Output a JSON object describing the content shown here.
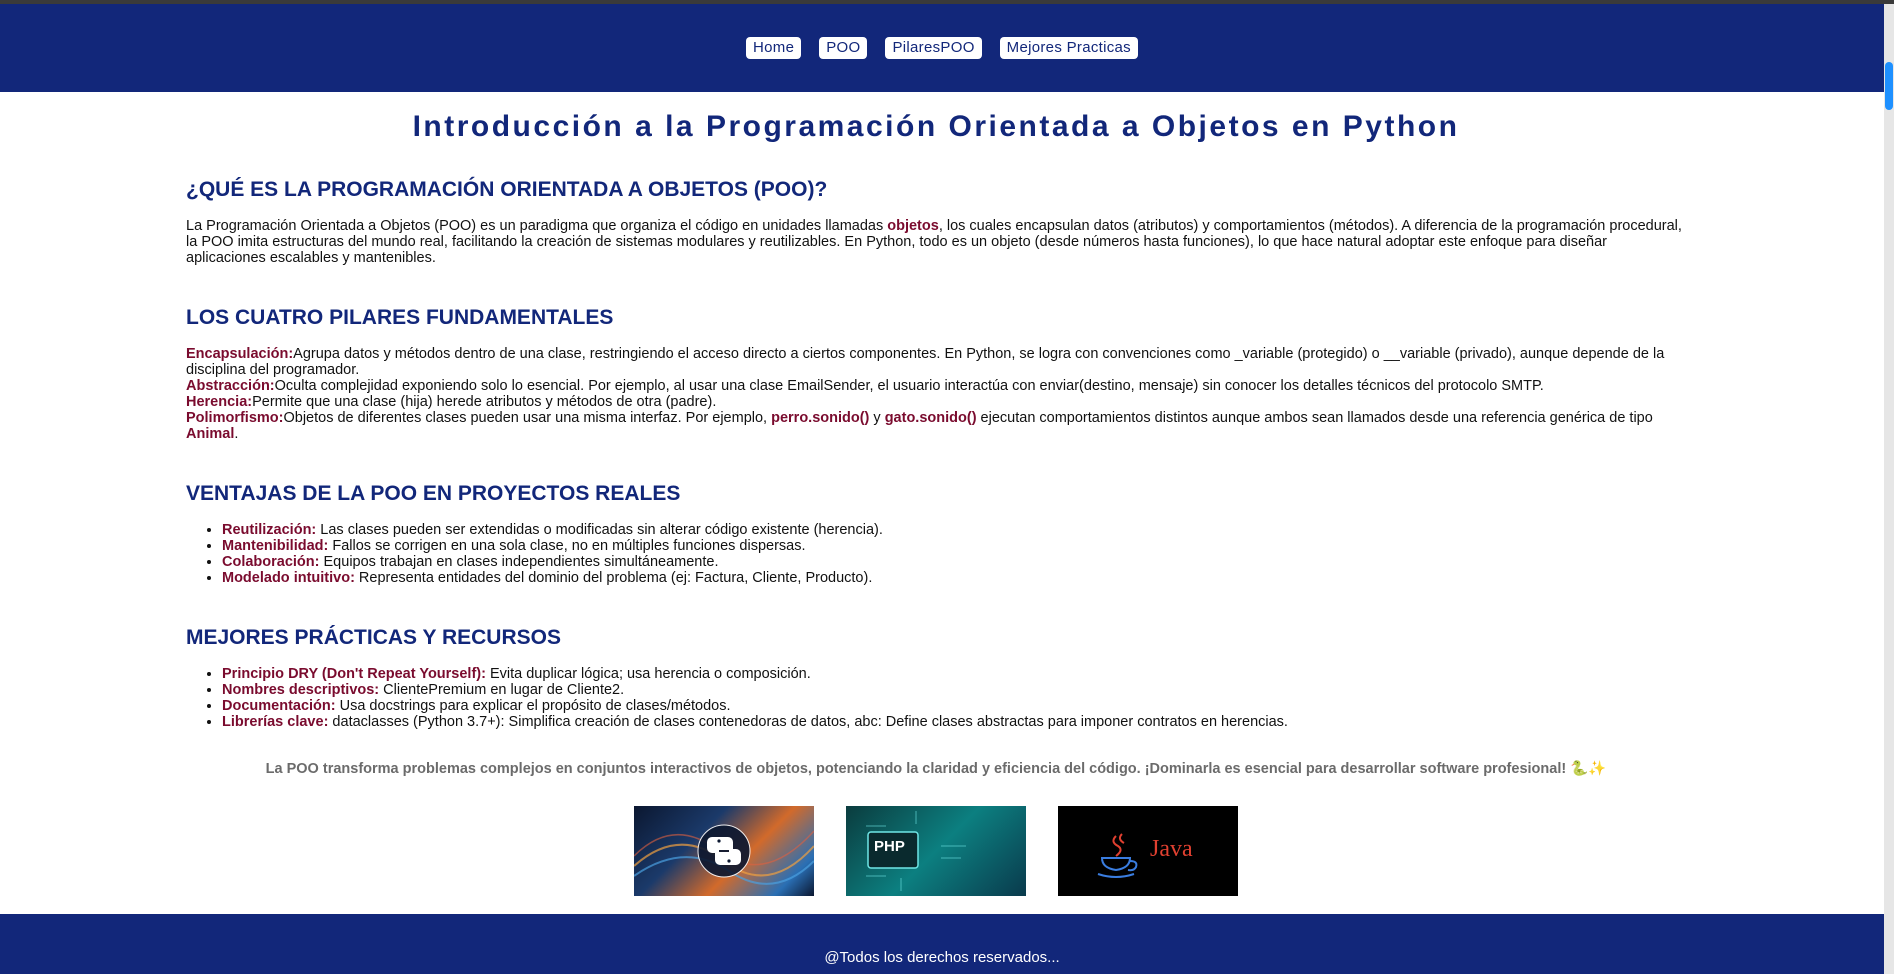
{
  "nav": {
    "items": [
      {
        "label": "Home"
      },
      {
        "label": "POO"
      },
      {
        "label": "PilaresPOO"
      },
      {
        "label": "Mejores Practicas"
      }
    ]
  },
  "title": "Introducción a la Programación Orientada a Objetos en Python",
  "sections": {
    "what_is": {
      "heading": "¿QUÉ ES LA PROGRAMACIÓN ORIENTADA A OBJETOS (POO)?",
      "text_before": "La Programación Orientada a Objetos (POO) es un paradigma que organiza el código en unidades llamadas ",
      "highlight": "objetos",
      "text_after": ", los cuales encapsulan datos (atributos) y comportamientos (métodos). A diferencia de la programación procedural, la POO imita estructuras del mundo real, facilitando la creación de sistemas modulares y reutilizables. En Python, todo es un objeto (desde números hasta funciones), lo que hace natural adoptar este enfoque para diseñar aplicaciones escalables y mantenibles."
    },
    "pillars": {
      "heading": "LOS CUATRO PILARES FUNDAMENTALES",
      "encapsulation": {
        "term": "Encapsulación:",
        "text": "Agrupa datos y métodos dentro de una clase, restringiendo el acceso directo a ciertos componentes. En Python, se logra con convenciones como _variable (protegido) o __variable (privado), aunque depende de la disciplina del programador."
      },
      "abstraction": {
        "term": "Abstracción:",
        "text": "Oculta complejidad exponiendo solo lo esencial. Por ejemplo, al usar una clase EmailSender, el usuario interactúa con enviar(destino, mensaje) sin conocer los detalles técnicos del protocolo SMTP."
      },
      "inheritance": {
        "term": "Herencia:",
        "text": "Permite que una clase (hija) herede atributos y métodos de otra (padre)."
      },
      "polymorphism": {
        "term": "Polimorfismo:",
        "text1": "Objetos de diferentes clases pueden usar una misma interfaz. Por ejemplo, ",
        "code1": "perro.sonido()",
        "text2": " y ",
        "code2": "gato.sonido()",
        "text3": " ejecutan comportamientos distintos aunque ambos sean llamados desde una referencia genérica de tipo ",
        "code3": "Animal",
        "text4": "."
      }
    },
    "advantages": {
      "heading": "VENTAJAS DE LA POO EN PROYECTOS REALES",
      "items": [
        {
          "term": "Reutilización:",
          "text": " Las clases pueden ser extendidas o modificadas sin alterar código existente (herencia)."
        },
        {
          "term": "Mantenibilidad:",
          "text": " Fallos se corrigen en una sola clase, no en múltiples funciones dispersas."
        },
        {
          "term": "Colaboración:",
          "text": " Equipos trabajan en clases independientes simultáneamente."
        },
        {
          "term": "Modelado intuitivo:",
          "text": " Representa entidades del dominio del problema (ej: Factura, Cliente, Producto)."
        }
      ]
    },
    "best_practices": {
      "heading": "MEJORES PRÁCTICAS Y RECURSOS",
      "items": [
        {
          "term": "Principio DRY (Don't Repeat Yourself):",
          "text": " Evita duplicar lógica; usa herencia o composición."
        },
        {
          "term": "Nombres descriptivos:",
          "text": " ClientePremium en lugar de Cliente2."
        },
        {
          "term": "Documentación:",
          "text": " Usa docstrings para explicar el propósito de clases/métodos."
        },
        {
          "term": "Librerías clave:",
          "text": " dataclasses (Python 3.7+): Simplifica creación de clases contenedoras de datos, abc: Define clases abstractas para imponer contratos en herencias."
        }
      ]
    }
  },
  "closing": "La POO transforma problemas complejos en conjuntos interactivos de objetos, potenciando la claridad y eficiencia del código. ¡Dominarla es esencial para desarrollar software profesional! 🐍✨",
  "gallery": {
    "php_label": "PHP",
    "java_label": "Java"
  },
  "footer": "@Todos los derechos reservados...",
  "colors": {
    "navy": "#12277a",
    "accent": "#7a0b2e"
  }
}
